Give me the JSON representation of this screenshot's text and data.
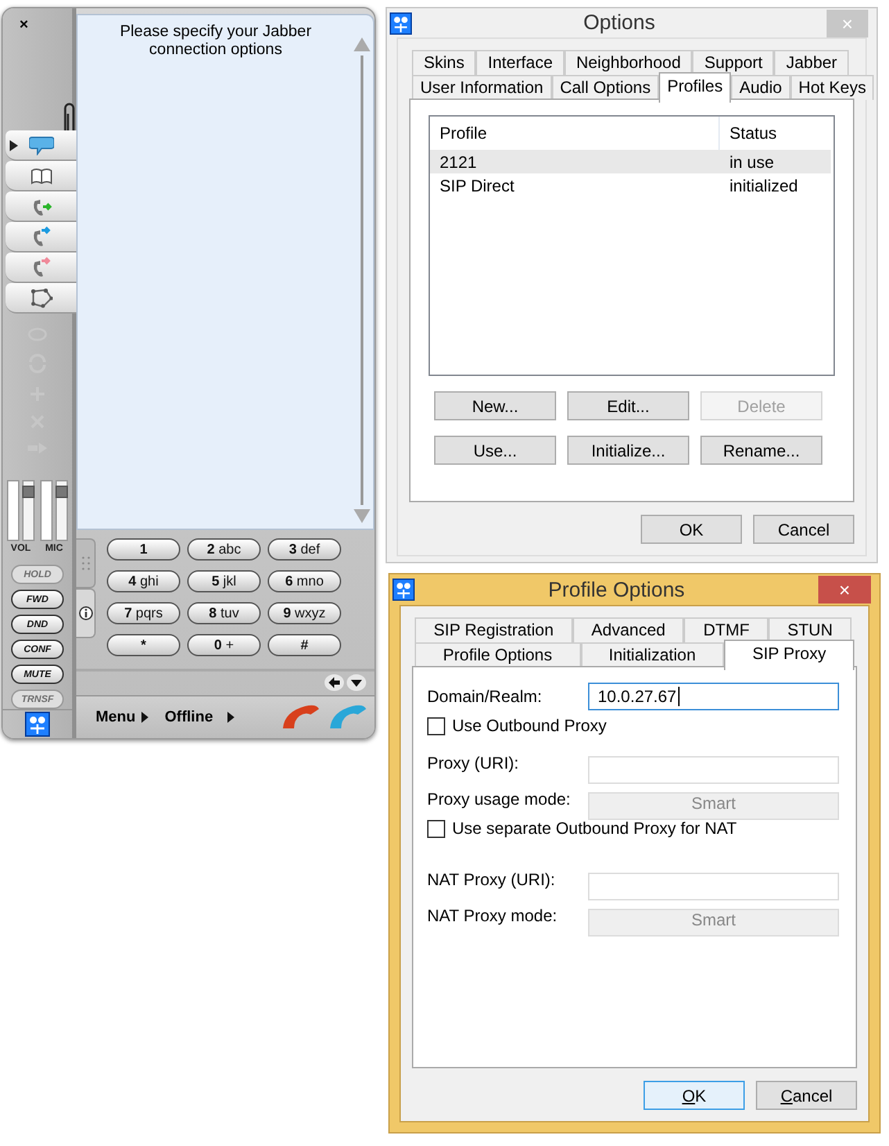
{
  "phone": {
    "close": "×",
    "message": "Please specify your Jabber connection options",
    "side_tabs": [
      {
        "kind": "chat",
        "selected": true
      },
      {
        "kind": "book",
        "selected": false
      },
      {
        "kind": "outgoing",
        "selected": false
      },
      {
        "kind": "incoming",
        "selected": false
      },
      {
        "kind": "missed",
        "selected": false
      },
      {
        "kind": "network",
        "selected": false
      }
    ],
    "sliders": [
      {
        "label": "VOL",
        "level": 0.9
      },
      {
        "label": "MIC",
        "level": 0.9
      }
    ],
    "function_buttons": [
      {
        "label": "HOLD",
        "disabled": true
      },
      {
        "label": "FWD",
        "disabled": false
      },
      {
        "label": "DND",
        "disabled": false
      },
      {
        "label": "CONF",
        "disabled": false
      },
      {
        "label": "MUTE",
        "disabled": false
      },
      {
        "label": "TRNSF",
        "disabled": true
      }
    ],
    "keypad": [
      {
        "digit": "1"
      },
      {
        "digit": "2",
        "letters": "abc"
      },
      {
        "digit": "3",
        "letters": "def"
      },
      {
        "digit": "4",
        "letters": "ghi"
      },
      {
        "digit": "5",
        "letters": "jkl"
      },
      {
        "digit": "6",
        "letters": "mno"
      },
      {
        "digit": "7",
        "letters": "pqrs"
      },
      {
        "digit": "8",
        "letters": "tuv"
      },
      {
        "digit": "9",
        "letters": "wxyz"
      },
      {
        "digit": "*"
      },
      {
        "digit": "0",
        "letters": "+"
      },
      {
        "digit": "#"
      }
    ],
    "menu": "Menu",
    "status": "Offline"
  },
  "options": {
    "title": "Options",
    "active": false,
    "close": "×",
    "tab_rows": [
      [
        {
          "label": "Skins",
          "selected": false
        },
        {
          "label": "Interface",
          "selected": false
        },
        {
          "label": "Neighborhood",
          "selected": false
        },
        {
          "label": "Support",
          "selected": false
        },
        {
          "label": "Jabber",
          "selected": false
        }
      ],
      [
        {
          "label": "User Information",
          "selected": false
        },
        {
          "label": "Call Options",
          "selected": false
        },
        {
          "label": "Profiles",
          "selected": true
        },
        {
          "label": "Audio",
          "selected": false
        },
        {
          "label": "Hot Keys",
          "selected": false
        }
      ]
    ],
    "table": {
      "columns": [
        "Profile",
        "Status"
      ],
      "rows": [
        {
          "profile": "2121",
          "status": "in use",
          "selected": true
        },
        {
          "profile": "SIP Direct",
          "status": "initialized",
          "selected": false
        }
      ]
    },
    "buttons": [
      {
        "label": "New...",
        "disabled": false
      },
      {
        "label": "Edit...",
        "disabled": false
      },
      {
        "label": "Delete",
        "disabled": true
      },
      {
        "label": "Use...",
        "disabled": false
      },
      {
        "label": "Initialize...",
        "disabled": false
      },
      {
        "label": "Rename...",
        "disabled": false
      }
    ],
    "footer_buttons": [
      {
        "label": "OK",
        "default": false
      },
      {
        "label": "Cancel",
        "default": false
      }
    ]
  },
  "profile_options": {
    "title": "Profile Options",
    "active": true,
    "close": "×",
    "tab_rows": [
      [
        {
          "label": "SIP Registration",
          "selected": false
        },
        {
          "label": "Advanced",
          "selected": false
        },
        {
          "label": "DTMF",
          "selected": false
        },
        {
          "label": "STUN",
          "selected": false
        }
      ],
      [
        {
          "label": "Profile Options",
          "selected": false
        },
        {
          "label": "Initialization",
          "selected": false
        },
        {
          "label": "SIP Proxy",
          "selected": true
        }
      ]
    ],
    "fields": [
      {
        "kind": "text",
        "label": "Domain/Realm:",
        "value": "10.0.27.67",
        "focused": true,
        "disabled": false
      },
      {
        "kind": "checkbox",
        "label": "Use Outbound Proxy",
        "checked": false
      },
      {
        "kind": "text",
        "label": "Proxy (URI):",
        "focused": false,
        "disabled": true
      },
      {
        "kind": "select",
        "label": "Proxy usage mode:",
        "value": "Smart",
        "disabled": true
      },
      {
        "kind": "checkbox",
        "label": "Use separate Outbound Proxy for NAT",
        "checked": false
      },
      {
        "kind": "text",
        "label": "NAT Proxy (URI):",
        "focused": false,
        "disabled": true
      },
      {
        "kind": "select",
        "label": "NAT Proxy mode:",
        "value": "Smart",
        "disabled": true
      }
    ],
    "footer_buttons": [
      {
        "label": "OK",
        "default": true
      },
      {
        "label": "Cancel",
        "default": false
      }
    ]
  }
}
